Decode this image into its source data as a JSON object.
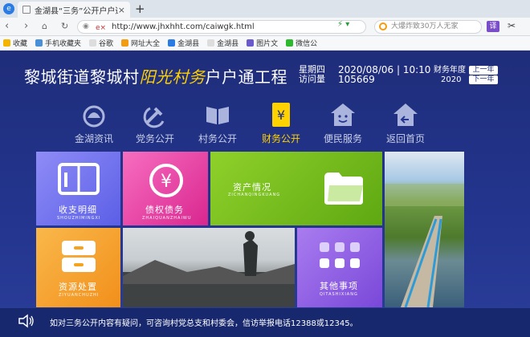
{
  "browser": {
    "tab_title": "金湖县“三务”公开户户通工程",
    "tab_close": "×",
    "new_tab": "+",
    "url": "http://www.jhxhht.com/caiwgk.html",
    "search_placeholder": "大爆炸致30万人无家",
    "tool_label": "译"
  },
  "bookmarks": [
    {
      "label": "收藏",
      "color": "#f5b400"
    },
    {
      "label": "手机收藏夹",
      "color": "#4a90d9"
    },
    {
      "label": "谷歌",
      "color": "#dddddd"
    },
    {
      "label": "网址大全",
      "color": "#f39c12"
    },
    {
      "label": "金湖县",
      "color": "#2a7be4"
    },
    {
      "label": "金湖县",
      "color": "#dddddd"
    },
    {
      "label": "图片文",
      "color": "#6a5acd"
    },
    {
      "label": "微信公",
      "color": "#2eb82e"
    }
  ],
  "header": {
    "title_pre": "黎城街道黎城村",
    "title_hl": "阳光村务",
    "title_post": "户户通工程",
    "weekday": "星期四",
    "visits_label": "访问量",
    "date": "2020/08/06",
    "time": "10:10",
    "visits": "105669",
    "fiscal_label": "财务年度",
    "fiscal_year": "2020",
    "prev_year": "上一年",
    "next_year": "下一年"
  },
  "nav": [
    {
      "label": "金湖资讯",
      "icon": "jinhu-news-icon"
    },
    {
      "label": "党务公开",
      "icon": "party-hammer-sickle-icon"
    },
    {
      "label": "村务公开",
      "icon": "open-book-icon"
    },
    {
      "label": "财务公开",
      "icon": "yuan-ledger-icon",
      "active": true
    },
    {
      "label": "便民服务",
      "icon": "smiling-house-icon"
    },
    {
      "label": "返回首页",
      "icon": "home-return-icon"
    }
  ],
  "tiles": {
    "income": {
      "title": "收支明细",
      "sub": "SHOUZHIMINGXI"
    },
    "debt": {
      "title": "债权债务",
      "sub": "ZHAIQUANZHAIWU"
    },
    "assets": {
      "title": "资产情况",
      "sub": "ZICHANQINGKUANG"
    },
    "resources": {
      "title": "资源处置",
      "sub": "ZIYUANCHUZHI"
    },
    "other": {
      "title": "其他事项",
      "sub": "QITASHIXIANG"
    }
  },
  "colors": {
    "page_bg": "#1f2d7a",
    "accent_yellow": "#ffd200",
    "tile_income": "#6a6cf0",
    "tile_debt": "#e0359a",
    "tile_assets": "#7cc21f",
    "tile_resources": "#f5a31f",
    "tile_other": "#8a5ce0"
  },
  "footer": {
    "notice": "如对三务公开内容有疑问，可咨询村党总支和村委会，信访举报电话12388或12345。"
  }
}
